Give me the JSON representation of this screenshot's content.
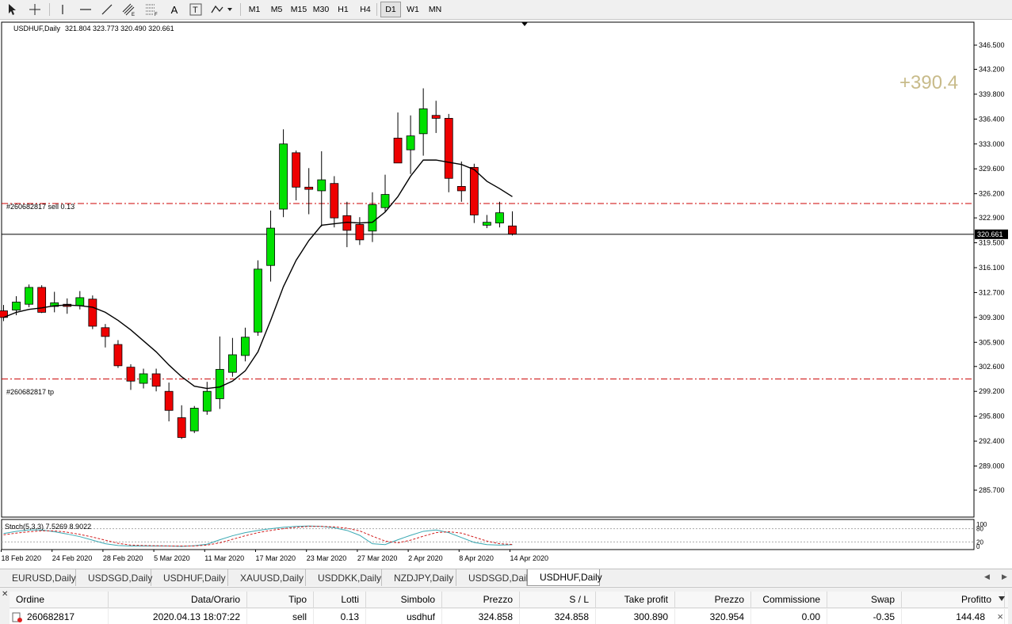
{
  "toolbar": {
    "tools": [
      {
        "name": "cursor-arrow-icon"
      },
      {
        "name": "crosshair-icon"
      },
      {
        "name": "vertical-line-icon"
      },
      {
        "name": "horizontal-line-icon"
      },
      {
        "name": "trendline-icon"
      },
      {
        "name": "equidistant-channel-icon"
      },
      {
        "name": "fibonacci-icon"
      },
      {
        "name": "text-icon",
        "glyph": "A"
      },
      {
        "name": "text-label-icon",
        "glyph": "T"
      },
      {
        "name": "shapes-dropdown-icon"
      }
    ],
    "timeframes": [
      "M1",
      "M5",
      "M15",
      "M30",
      "H1",
      "H4",
      "D1",
      "W1",
      "MN"
    ],
    "active_timeframe": "D1"
  },
  "chart": {
    "symbol": "USDHUF,Daily",
    "ohlc": "321.804 323.773 320.490 320.661",
    "profit": "+390.4",
    "current_price": 320.661,
    "current_price_label": "320.661",
    "order_line_label": "#260682817 sell 0.13",
    "order_price": 324.858,
    "tp_line_label": "#260682817 tp",
    "tp_price": 300.89,
    "stoch_label": "Stoch(5,3,3) 7.5269 8.9022"
  },
  "chart_data": {
    "type": "candlestick",
    "y_axis": {
      "ticks": [
        "346.500",
        "343.200",
        "339.800",
        "336.400",
        "333.000",
        "329.600",
        "326.200",
        "322.900",
        "319.500",
        "316.100",
        "312.700",
        "309.300",
        "305.900",
        "302.600",
        "299.200",
        "295.800",
        "292.400",
        "289.000",
        "285.700"
      ],
      "range": [
        285.7,
        346.5
      ]
    },
    "x_axis_labels": [
      "18 Feb 2020",
      "24 Feb 2020",
      "28 Feb 2020",
      "5 Mar 2020",
      "11 Mar 2020",
      "17 Mar 2020",
      "23 Mar 2020",
      "27 Mar 2020",
      "2 Apr 2020",
      "8 Apr 2020",
      "14 Apr 2020"
    ],
    "candles": [
      {
        "o": 310.2,
        "h": 311.0,
        "l": 308.8,
        "c": 309.3
      },
      {
        "o": 310.3,
        "h": 312.2,
        "l": 309.6,
        "c": 311.4
      },
      {
        "o": 311.1,
        "h": 313.8,
        "l": 310.7,
        "c": 313.4
      },
      {
        "o": 313.4,
        "h": 313.7,
        "l": 309.9,
        "c": 310.0
      },
      {
        "o": 310.8,
        "h": 312.8,
        "l": 310.0,
        "c": 311.3
      },
      {
        "o": 311.1,
        "h": 311.9,
        "l": 309.8,
        "c": 310.8
      },
      {
        "o": 310.9,
        "h": 312.9,
        "l": 310.4,
        "c": 312.0
      },
      {
        "o": 311.8,
        "h": 312.3,
        "l": 307.7,
        "c": 308.1
      },
      {
        "o": 307.9,
        "h": 308.4,
        "l": 305.2,
        "c": 306.7
      },
      {
        "o": 305.6,
        "h": 306.2,
        "l": 302.4,
        "c": 302.7
      },
      {
        "o": 302.5,
        "h": 302.9,
        "l": 299.4,
        "c": 300.6
      },
      {
        "o": 300.3,
        "h": 302.3,
        "l": 299.6,
        "c": 301.6
      },
      {
        "o": 301.6,
        "h": 302.3,
        "l": 299.2,
        "c": 299.9
      },
      {
        "o": 299.2,
        "h": 300.4,
        "l": 295.1,
        "c": 296.6
      },
      {
        "o": 295.6,
        "h": 297.3,
        "l": 292.7,
        "c": 292.9
      },
      {
        "o": 293.8,
        "h": 297.2,
        "l": 293.5,
        "c": 296.9
      },
      {
        "o": 296.5,
        "h": 300.5,
        "l": 296.0,
        "c": 299.2
      },
      {
        "o": 298.2,
        "h": 306.7,
        "l": 296.8,
        "c": 302.2
      },
      {
        "o": 301.8,
        "h": 306.5,
        "l": 301.2,
        "c": 304.2
      },
      {
        "o": 304.1,
        "h": 307.9,
        "l": 303.3,
        "c": 306.6
      },
      {
        "o": 307.3,
        "h": 317.1,
        "l": 306.8,
        "c": 315.9
      },
      {
        "o": 316.4,
        "h": 323.9,
        "l": 314.2,
        "c": 321.5
      },
      {
        "o": 324.1,
        "h": 335.0,
        "l": 323.0,
        "c": 333.0
      },
      {
        "o": 331.8,
        "h": 332.1,
        "l": 325.3,
        "c": 327.1
      },
      {
        "o": 327.1,
        "h": 329.7,
        "l": 323.4,
        "c": 326.8
      },
      {
        "o": 326.6,
        "h": 332.0,
        "l": 321.7,
        "c": 328.1
      },
      {
        "o": 327.6,
        "h": 328.6,
        "l": 321.6,
        "c": 322.9
      },
      {
        "o": 323.2,
        "h": 325.1,
        "l": 318.9,
        "c": 321.2
      },
      {
        "o": 322.0,
        "h": 323.0,
        "l": 319.2,
        "c": 319.9
      },
      {
        "o": 321.1,
        "h": 326.4,
        "l": 319.6,
        "c": 324.7
      },
      {
        "o": 324.3,
        "h": 328.8,
        "l": 323.7,
        "c": 326.1
      },
      {
        "o": 333.8,
        "h": 337.3,
        "l": 331.2,
        "c": 330.4
      },
      {
        "o": 332.2,
        "h": 336.9,
        "l": 328.9,
        "c": 334.1
      },
      {
        "o": 334.4,
        "h": 340.6,
        "l": 331.4,
        "c": 337.8
      },
      {
        "o": 336.9,
        "h": 338.9,
        "l": 334.5,
        "c": 336.5
      },
      {
        "o": 336.5,
        "h": 337.1,
        "l": 326.4,
        "c": 328.3
      },
      {
        "o": 327.2,
        "h": 330.6,
        "l": 325.1,
        "c": 326.6
      },
      {
        "o": 329.8,
        "h": 330.3,
        "l": 322.2,
        "c": 323.3
      },
      {
        "o": 321.9,
        "h": 323.3,
        "l": 321.5,
        "c": 322.3
      },
      {
        "o": 322.2,
        "h": 325.1,
        "l": 321.6,
        "c": 323.6
      },
      {
        "o": 321.8,
        "h": 323.8,
        "l": 320.5,
        "c": 320.7
      }
    ],
    "ma": [
      309.3,
      310.0,
      310.4,
      310.6,
      310.9,
      311.0,
      310.9,
      310.7,
      310.0,
      308.9,
      307.6,
      306.1,
      304.6,
      302.8,
      301.2,
      299.9,
      299.6,
      299.8,
      300.6,
      302.0,
      304.6,
      308.9,
      313.5,
      317.1,
      319.8,
      321.9,
      322.1,
      322.3,
      322.2,
      322.3,
      323.7,
      325.8,
      328.6,
      330.8,
      330.8,
      330.5,
      330.2,
      329.5,
      327.9,
      326.9,
      325.8
    ],
    "stochastic": {
      "range": [
        0,
        100
      ],
      "ticks": [
        "100",
        "80",
        "20",
        "0"
      ],
      "main": [
        58,
        68,
        74,
        74,
        66,
        56,
        44,
        28,
        12,
        4,
        2,
        2,
        2,
        2,
        0,
        3,
        10,
        30,
        48,
        62,
        72,
        80,
        86,
        90,
        92,
        90,
        84,
        72,
        50,
        12,
        8,
        30,
        50,
        68,
        74,
        62,
        40,
        18,
        8,
        6,
        7.5
      ],
      "signal": [
        52,
        60,
        66,
        70,
        70,
        64,
        54,
        42,
        28,
        14,
        6,
        4,
        3,
        2,
        2,
        2,
        6,
        16,
        32,
        48,
        62,
        72,
        80,
        86,
        90,
        90,
        88,
        82,
        70,
        46,
        24,
        16,
        28,
        46,
        62,
        66,
        60,
        42,
        24,
        12,
        8.9
      ]
    }
  },
  "tabs": {
    "items": [
      "EURUSD,Daily",
      "USDSGD,Daily",
      "USDHUF,Daily",
      "XAUUSD,Daily",
      "USDDKK,Daily",
      "NZDJPY,Daily",
      "USDSGD,Daily",
      "USDHUF,Daily"
    ],
    "active_index": 7
  },
  "orders": {
    "headers": [
      "Ordine",
      "Data/Orario",
      "Tipo",
      "Lotti",
      "Simbolo",
      "Prezzo",
      "S / L",
      "Take profit",
      "Prezzo",
      "Commissione",
      "Swap",
      "Profitto"
    ],
    "rows": [
      [
        "260682817",
        "2020.04.13 18:07:22",
        "sell",
        "0.13",
        "usdhuf",
        "324.858",
        "324.858",
        "300.890",
        "320.954",
        "0.00",
        "-0.35",
        "144.48"
      ]
    ]
  },
  "colors": {
    "bull": "#00e000",
    "bear": "#ee0000",
    "ma_line": "#000000",
    "order_line": "#cc0000",
    "profit_text": "#c8bb8a",
    "stoch_main": "#3aa9b3",
    "stoch_signal": "#d22020"
  }
}
